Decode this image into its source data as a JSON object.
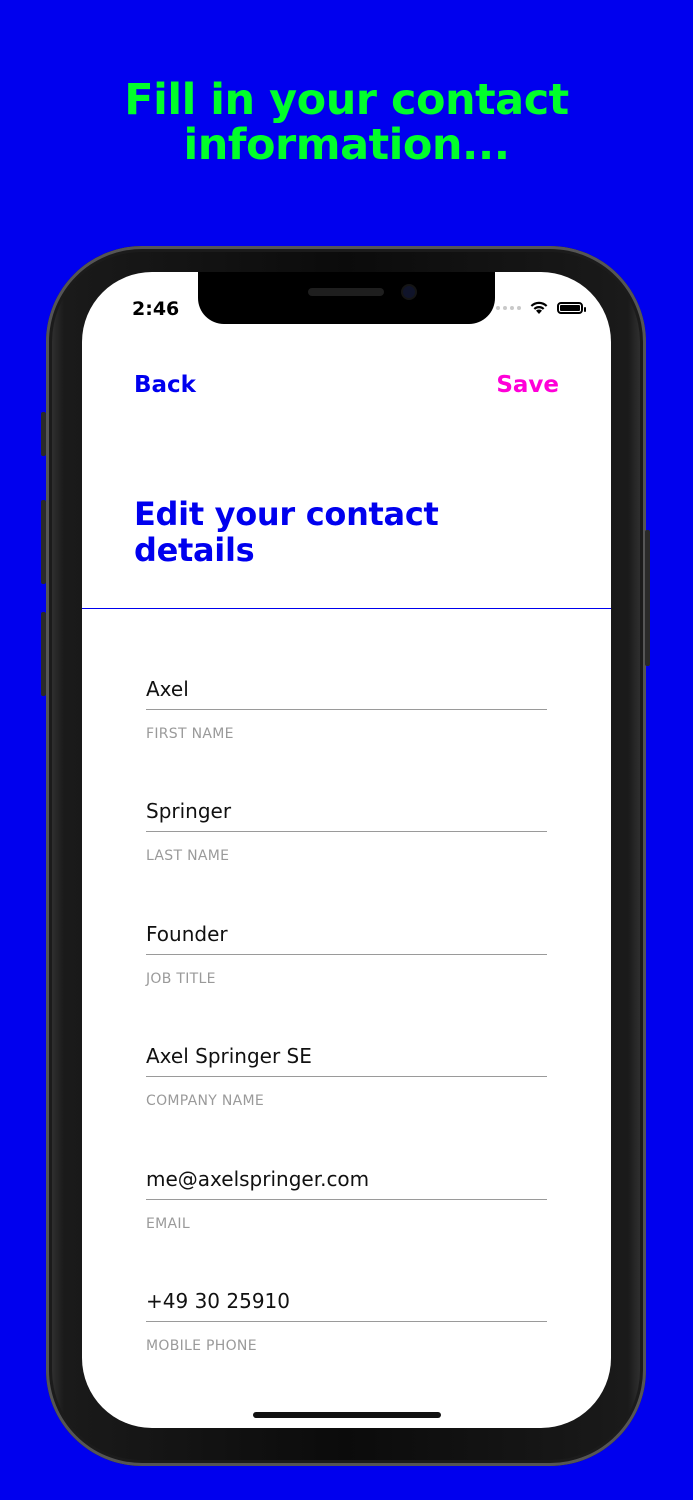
{
  "promo": {
    "title_line1": "Fill in your contact",
    "title_line2": "information..."
  },
  "status_bar": {
    "time": "2:46",
    "wifi_icon": "wifi-icon",
    "battery_icon": "battery-icon"
  },
  "nav": {
    "back_label": "Back",
    "save_label": "Save"
  },
  "page": {
    "title": "Edit your contact details"
  },
  "fields": [
    {
      "value": "Axel",
      "label": "FIRST NAME"
    },
    {
      "value": "Springer",
      "label": "LAST NAME"
    },
    {
      "value": "Founder",
      "label": "JOB TITLE"
    },
    {
      "value": "Axel Springer SE",
      "label": "COMPANY NAME"
    },
    {
      "value": "me@axelspringer.com",
      "label": "EMAIL"
    },
    {
      "value": "+49 30 25910",
      "label": "MOBILE PHONE"
    }
  ],
  "colors": {
    "background": "#0000ee",
    "promo_text": "#00ff2a",
    "accent": "#0000ee",
    "save": "#ff00d8"
  }
}
